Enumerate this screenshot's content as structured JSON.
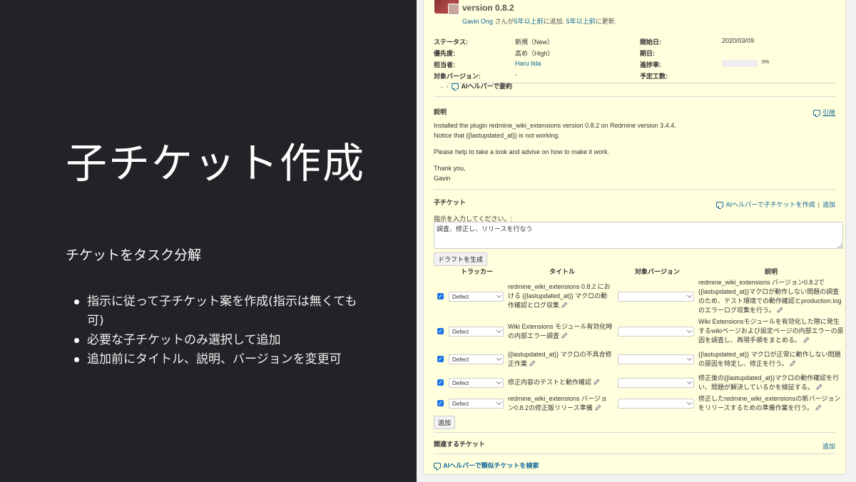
{
  "slide": {
    "title": "子チケット作成",
    "subtitle": "チケットをタスク分解",
    "bullets": [
      "指示に従って子チケット案を作成(指示は無くても可)",
      "必要な子チケットのみ選択して追加",
      "追加前にタイトル、説明、バージョンを変更可"
    ]
  },
  "issue": {
    "version_title": "version 0.8.2",
    "author": "Gavin Ong",
    "author_suffix": " さんが",
    "added_link": "5年以上前",
    "added_text": "に追加. ",
    "updated_link": "5年以上前",
    "updated_text": "に更新.",
    "attributes": {
      "status_label": "ステータス:",
      "status_value": "新規（New）",
      "priority_label": "優先度:",
      "priority_value": "高め（High）",
      "assignee_label": "担当者:",
      "assignee_value": "Haru Iida",
      "target_version_label": "対象バージョン:",
      "target_version_value": "-",
      "start_date_label": "開始日:",
      "start_date_value": "2020/03/09",
      "due_date_label": "期日:",
      "progress_label": "進捗率:",
      "progress_value": "0%",
      "progress_fraction": 0,
      "estimate_label": "予定工数:"
    },
    "ai_summary": "AIヘルパーで要約",
    "description": {
      "title": "説明",
      "quote": "引用",
      "lines": [
        "Installed the plugin redmine_wiki_extensions version 0.8.2 on Redmine version 3.4.4.",
        "Notice that {{lastupdated_at}} is not working.",
        "Please help to take a look and advise on how to make it work.",
        "Thank you,",
        "Gavin"
      ]
    },
    "subtasks": {
      "title": "子チケット",
      "ai_create": "AIヘルパーで子チケットを作成",
      "separator": "|",
      "add": "追加",
      "instruction_label": "指示を入力してください。:",
      "instruction_value": "調査、修正し、リリースを行なう",
      "generate_button": "ドラフトを生成",
      "headers": {
        "tracker": "トラッカー",
        "title": "タイトル",
        "version": "対象バージョン",
        "description": "説明"
      },
      "rows": [
        {
          "tracker": "Defect",
          "title": [
            "redmine_wiki_extensions 0.8.2 にお",
            "ける {{lastupdated_at}} マクロの動",
            "作確認とログ収集"
          ],
          "description": [
            "redmine_wiki_extensions バージョン0.8.2で",
            "{{lastupdated_at}}マクロが動作しない問題の調査",
            "のため、テスト環境での動作確認とproduction.log",
            "のエラーログ収集を行う。"
          ]
        },
        {
          "tracker": "Defect",
          "title": [
            "Wiki Extensions モジュール有効化時",
            "の内部エラー調査"
          ],
          "description": [
            "Wiki Extensionsモジュールを有効化した際に発生",
            "するwikiページおよび設定ページの内部エラーの原",
            "因を調査し、再現手順をまとめる。"
          ]
        },
        {
          "tracker": "Defect",
          "title": [
            "{{lastupdated_at}} マクロの不具合修",
            "正作業"
          ],
          "description": [
            "{{lastupdated_at}} マクロが正常に動作しない問題",
            "の原因を特定し、修正を行う。"
          ]
        },
        {
          "tracker": "Defect",
          "title": [
            "修正内容のテストと動作確認"
          ],
          "description": [
            "修正後の{{lastupdated_at}}マクロの動作確認を行",
            "い、問題が解決しているかを検証する。"
          ]
        },
        {
          "tracker": "Defect",
          "title": [
            "redmine_wiki_extensions バージョ",
            "ン0.8.2の修正版リリース準備"
          ],
          "description": [
            "修正したredmine_wiki_extensionsの新バージョン",
            "をリリースするための準備作業を行う。"
          ]
        }
      ],
      "add_button": "追加"
    },
    "related": {
      "title": "関連するチケット",
      "add": "追加"
    },
    "similar_search": "AIヘルパーで類似チケットを検索",
    "link_color": "#116699",
    "checkbox_color": "#1a73e8"
  }
}
